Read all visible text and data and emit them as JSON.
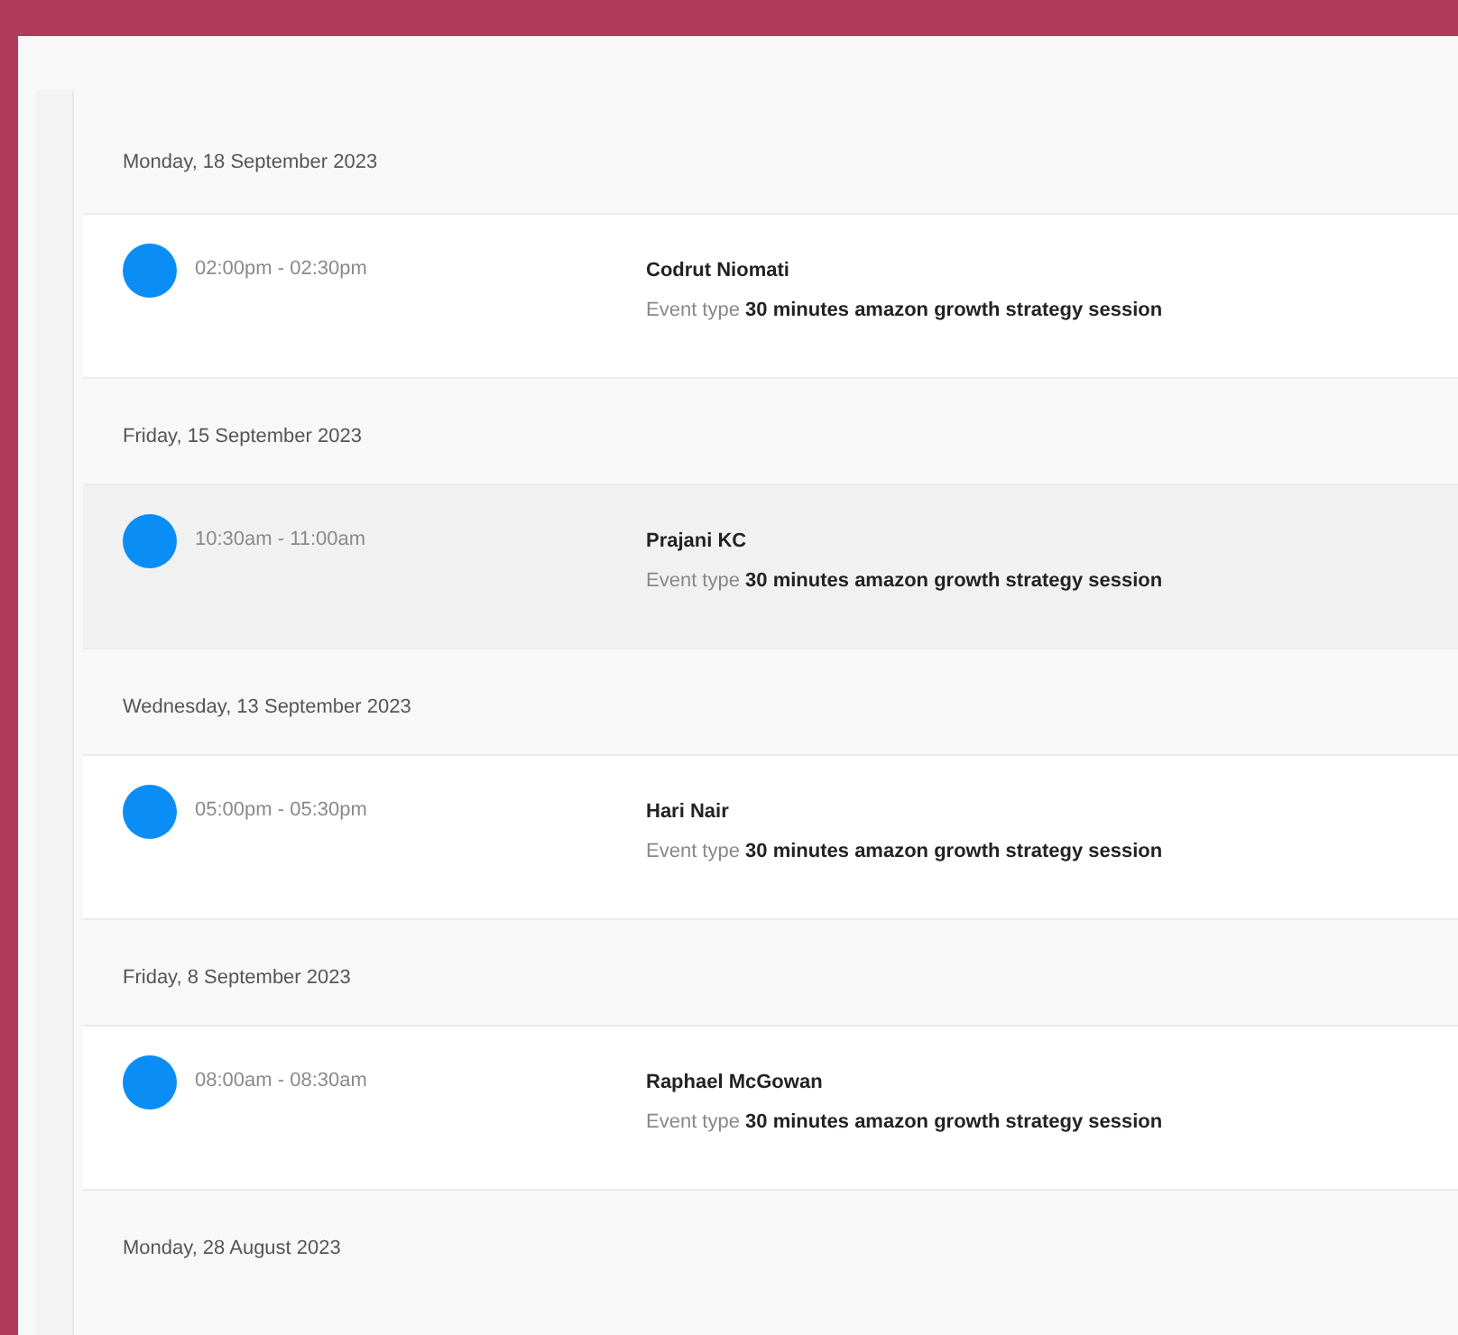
{
  "days": [
    {
      "date": "Monday, 18 September 2023",
      "bookings": [
        {
          "time": "02:00pm - 02:30pm",
          "name": "Codrut Niomati",
          "event": "Event type **30 minutes amazon growth strategy session**",
          "highlighted": false
        }
      ]
    },
    {
      "date": "Friday, 15 September 2023",
      "bookings": [
        {
          "time": "10:30am - 11:00am",
          "name": "Prajani KC",
          "event": "Event type **30 minutes amazon growth strategy session**",
          "highlighted": true
        }
      ]
    },
    {
      "date": "Wednesday, 13 September 2023",
      "bookings": [
        {
          "time": "05:00pm - 05:30pm",
          "name": "Hari Nair",
          "event": "Event type **30 minutes amazon growth strategy session**",
          "highlighted": false
        }
      ]
    },
    {
      "date": "Friday, 8 September 2023",
      "bookings": [
        {
          "time": "08:00am - 08:30am",
          "name": "Raphael McGowan",
          "event": "Event type **30 minutes amazon growth strategy session**",
          "highlighted": false
        }
      ]
    },
    {
      "date": "Monday, 28 August 2023"
    }
  ]
}
